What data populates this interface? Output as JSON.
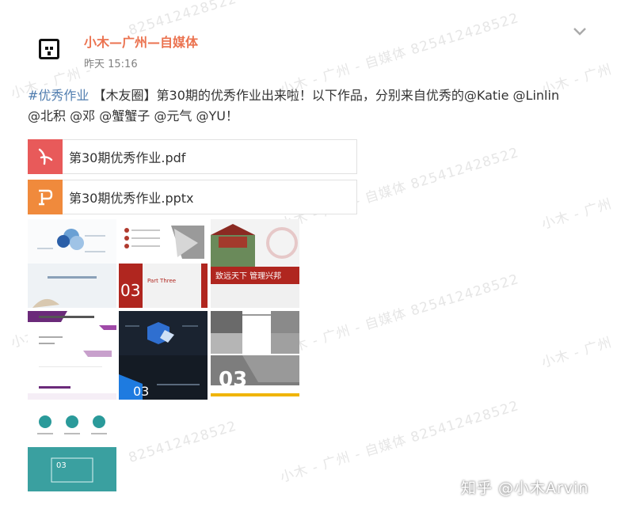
{
  "author": "小木—广州—自媒体",
  "time": "昨天 15:16",
  "post": {
    "topic": "#优秀作业",
    "text_a": " 【木友圈】第30期的优秀作业出来啦！以下作品，分别来自优秀的",
    "mentions": [
      "@Katie",
      "@Linlin",
      "@北积",
      "@邓",
      "@蟹蟹子",
      "@元气",
      "@YU"
    ],
    "text_b": "！"
  },
  "files": [
    {
      "name": "第30期优秀作业.pdf",
      "icon": "pdf-icon",
      "color": "#e85a5a"
    },
    {
      "name": "第30期优秀作业.pptx",
      "icon": "pptx-icon",
      "color": "#f08a3c"
    }
  ],
  "thumbs": {
    "t2_part": "Part Three",
    "t2_num": "03",
    "t3_banner": "致远天下 管理兴邦",
    "t5_num": "03",
    "t6_num": "03",
    "t7_num": "03"
  },
  "watermark": {
    "text": "小木 - 广州 - 自媒体 825412428522",
    "short": "小木 - 广州 -",
    "id": "825412428522"
  },
  "zhihu": "知乎 @小木Arvin",
  "colors": {
    "author": "#eb7350",
    "topic": "#507daf"
  }
}
